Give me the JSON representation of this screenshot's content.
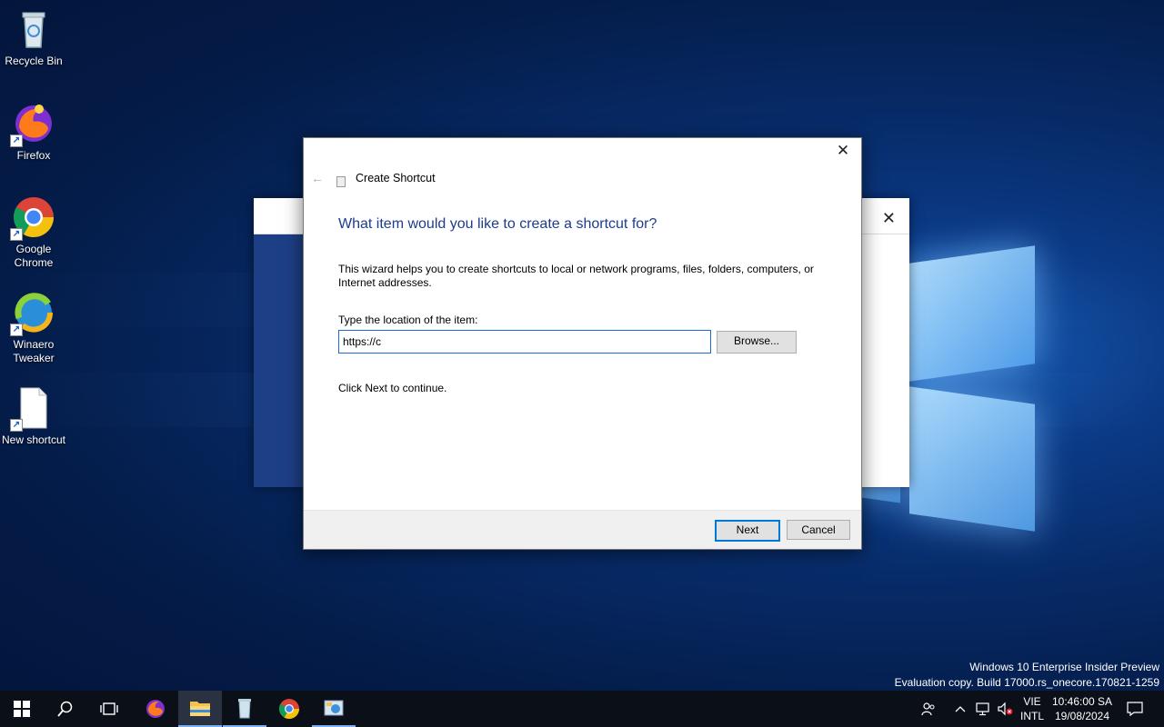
{
  "desktop": {
    "icons": [
      {
        "label": "Recycle Bin"
      },
      {
        "label": "Firefox"
      },
      {
        "label": "Google Chrome"
      },
      {
        "label": "Winaero Tweaker"
      },
      {
        "label": "New shortcut"
      }
    ]
  },
  "dialog": {
    "title": "Create Shortcut",
    "heading": "What item would you like to create a shortcut for?",
    "description": "This wizard helps you to create shortcuts to local or network programs, files, folders, computers, or Internet addresses.",
    "location_label": "Type the location of the item:",
    "location_value": "https://c",
    "browse_label": "Browse...",
    "hint": "Click Next to continue.",
    "next_label": "Next",
    "cancel_label": "Cancel",
    "close_glyph": "✕",
    "back_glyph": "←"
  },
  "background_window": {
    "close_glyph": "✕"
  },
  "watermark": {
    "line1": "Windows 10 Enterprise Insider Preview",
    "line2": "Evaluation copy. Build 17000.rs_onecore.170821-1259"
  },
  "taskbar": {
    "language_top": "VIE",
    "language_bottom": "INTL",
    "time": "10:46:00 SA",
    "date": "19/08/2024"
  },
  "colors": {
    "accent": "#0078d7",
    "heading": "#1c3c8c"
  }
}
